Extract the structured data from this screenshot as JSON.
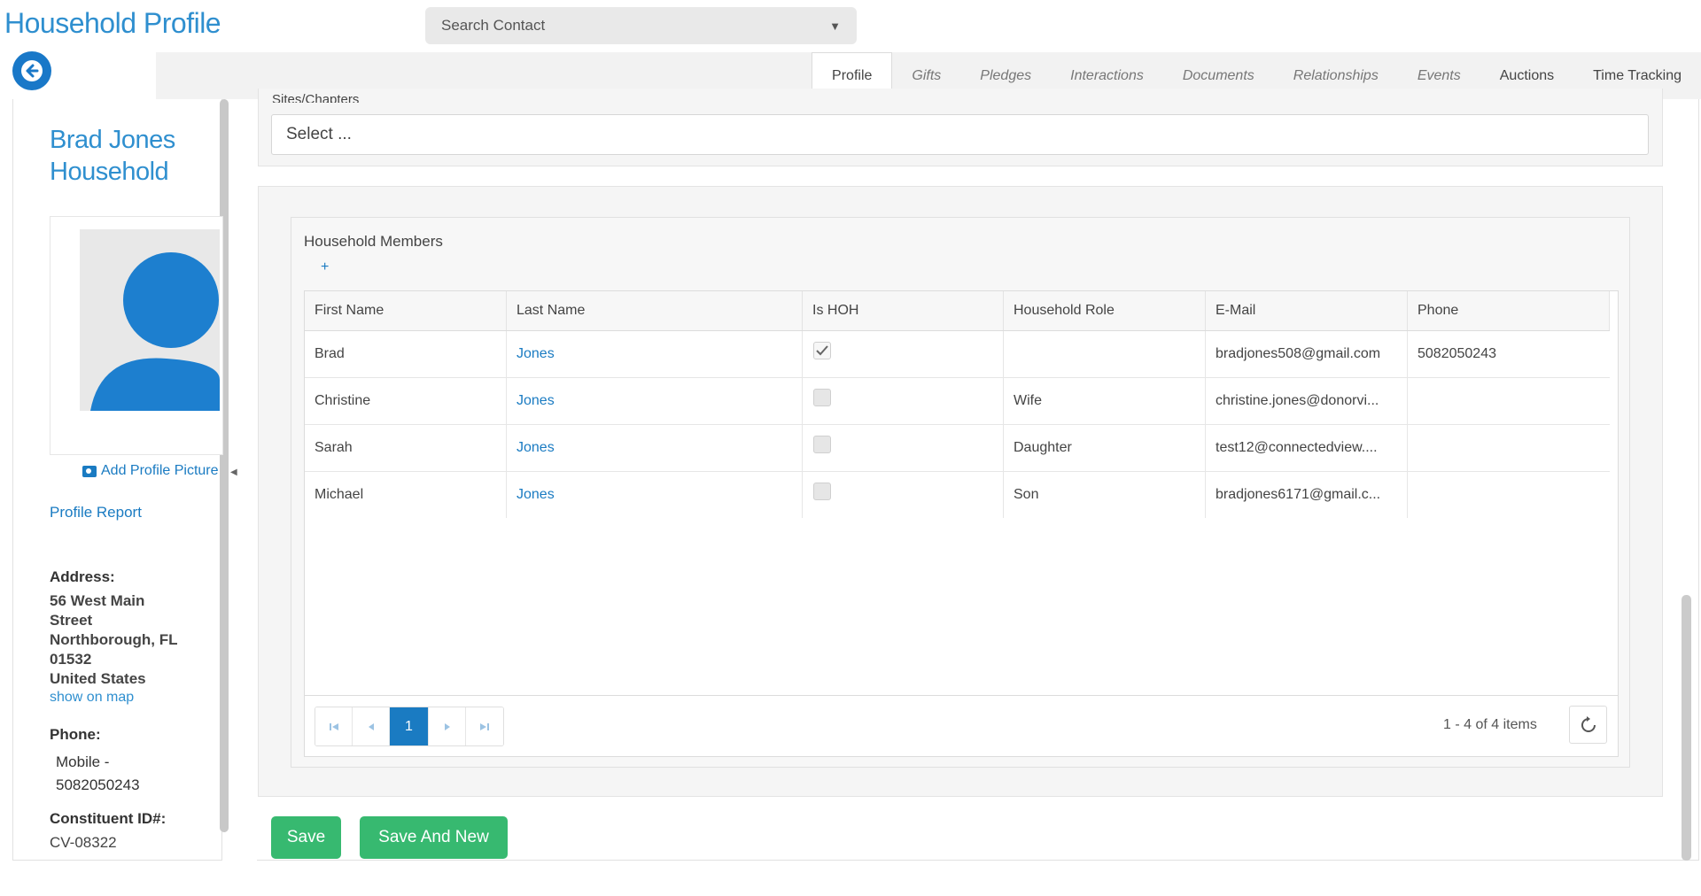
{
  "header": {
    "title": "Household Profile",
    "search": {
      "placeholder": "Search Contact"
    }
  },
  "tabs": [
    {
      "label": "Profile",
      "active": true
    },
    {
      "label": "Gifts"
    },
    {
      "label": "Pledges"
    },
    {
      "label": "Interactions"
    },
    {
      "label": "Documents"
    },
    {
      "label": "Relationships"
    },
    {
      "label": "Events"
    },
    {
      "label": "Auctions"
    },
    {
      "label": "Time Tracking"
    }
  ],
  "sidebar": {
    "name_line1": "Brad Jones",
    "name_line2": "Household",
    "add_picture": "Add Profile Picture",
    "profile_report": "Profile Report",
    "address_label": "Address:",
    "address_lines": [
      "56 West Main",
      "Street",
      "Northborough, FL",
      "01532",
      "United States"
    ],
    "show_on_map": "show on map",
    "phone_label": "Phone:",
    "phone_type": "Mobile -",
    "phone_number": "5082050243",
    "constituent_label": "Constituent ID#:",
    "constituent_id": "CV-08322"
  },
  "sites": {
    "label": "Sites/Chapters",
    "select_placeholder": "Select ..."
  },
  "members": {
    "title": "Household Members",
    "add_label": "+",
    "columns": [
      "First Name",
      "Last Name",
      "Is HOH",
      "Household Role",
      "E-Mail",
      "Phone"
    ],
    "rows": [
      {
        "first": "Brad",
        "last": "Jones",
        "hoh": true,
        "role": "",
        "email": "bradjones508@gmail.com",
        "phone": "5082050243"
      },
      {
        "first": "Christine",
        "last": "Jones",
        "hoh": false,
        "role": "Wife",
        "email": "christine.jones@donorvi...",
        "phone": ""
      },
      {
        "first": "Sarah",
        "last": "Jones",
        "hoh": false,
        "role": "Daughter",
        "email": "test12@connectedview....",
        "phone": ""
      },
      {
        "first": "Michael",
        "last": "Jones",
        "hoh": false,
        "role": "Son",
        "email": "bradjones6171@gmail.c...",
        "phone": ""
      }
    ],
    "pager": {
      "current_page": "1",
      "items_info": "1 - 4 of 4 items"
    }
  },
  "actions": {
    "save": "Save",
    "save_and_new": "Save And New"
  },
  "colors": {
    "brand_blue": "#2f8fcf",
    "link_blue": "#1a7bc2",
    "save_green": "#37b970"
  }
}
